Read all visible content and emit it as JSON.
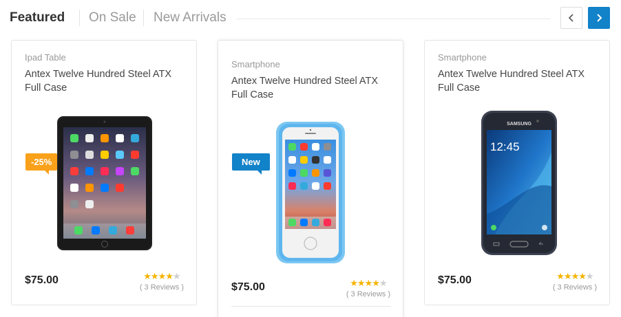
{
  "tabs": {
    "featured": "Featured",
    "on_sale": "On Sale",
    "new_arrivals": "New Arrivals"
  },
  "nav": {
    "prev_icon": "chevron-left-icon",
    "next_icon": "chevron-right-icon"
  },
  "colors": {
    "accent": "#1282c9",
    "sale_badge": "#f9a11b",
    "star": "#f5b301"
  },
  "products": [
    {
      "category": "Ipad Table",
      "title": "Antex Twelve Hundred Steel ATX Full Case",
      "price": "$75.00",
      "rating": 4,
      "rating_max": 5,
      "reviews": "( 3 Reviews )",
      "badge": "-25%",
      "image": "ipad-tablet-image"
    },
    {
      "category": "Smartphone",
      "title": "Antex Twelve Hundred Steel ATX Full Case",
      "price": "$75.00",
      "rating": 4,
      "rating_max": 5,
      "reviews": "( 3 Reviews )",
      "badge": "New",
      "image": "iphone-blue-case-image"
    },
    {
      "category": "Smartphone",
      "title": "Antex Twelve Hundred Steel ATX Full Case",
      "price": "$75.00",
      "rating": 4,
      "rating_max": 5,
      "reviews": "( 3 Reviews )",
      "image": "samsung-phone-image",
      "brand_text": "SAMSUNG",
      "screen_clock": "12:45"
    }
  ]
}
